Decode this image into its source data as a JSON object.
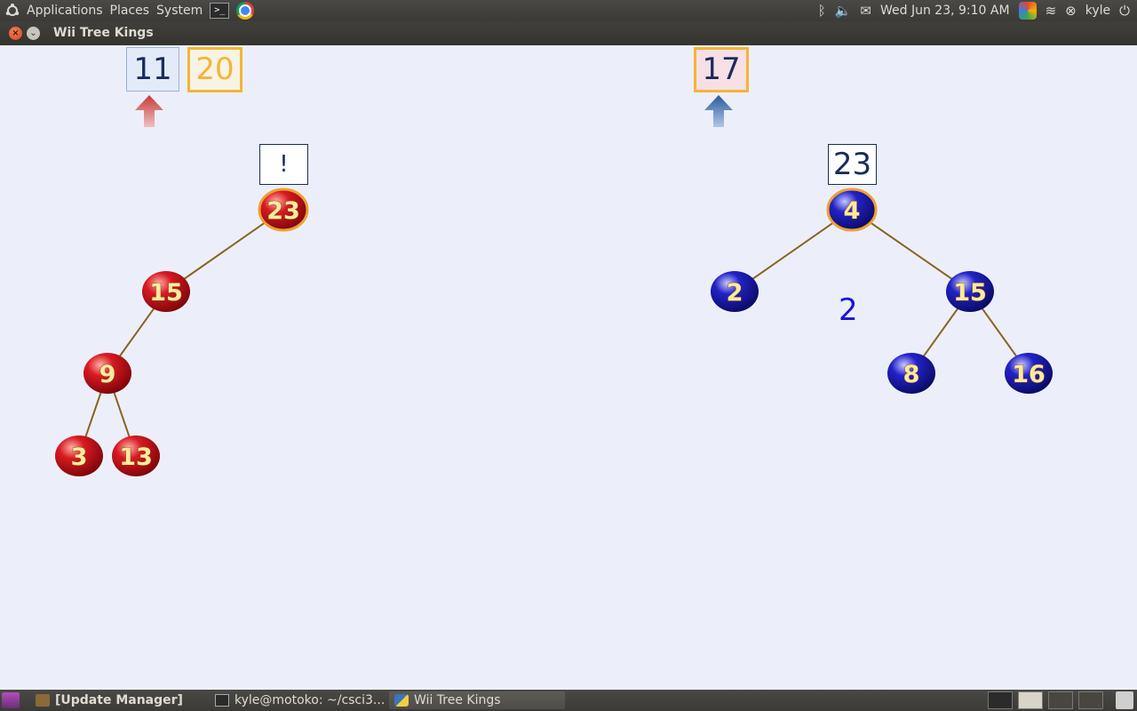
{
  "top_panel": {
    "menus": [
      "Applications",
      "Places",
      "System"
    ],
    "clock": "Wed Jun 23,  9:10 AM",
    "user": "kyle"
  },
  "window": {
    "title": "Wii Tree Kings"
  },
  "game": {
    "score_boxes": {
      "left_primary": "11",
      "left_secondary": "20",
      "right_primary": "17"
    },
    "left_tree_label": "!",
    "right_tree_label": "23",
    "floating_number": "2",
    "left_tree": {
      "color": "#c0101a",
      "nodes": [
        "23",
        "15",
        "9",
        "3",
        "13"
      ]
    },
    "right_tree": {
      "color": "#1a1ab0",
      "nodes": [
        "4",
        "2",
        "15",
        "8",
        "16"
      ]
    }
  },
  "taskbar": {
    "tasks": [
      "[Update Manager]",
      "kyle@motoko: ~/csci3...",
      "Wii Tree Kings"
    ]
  }
}
